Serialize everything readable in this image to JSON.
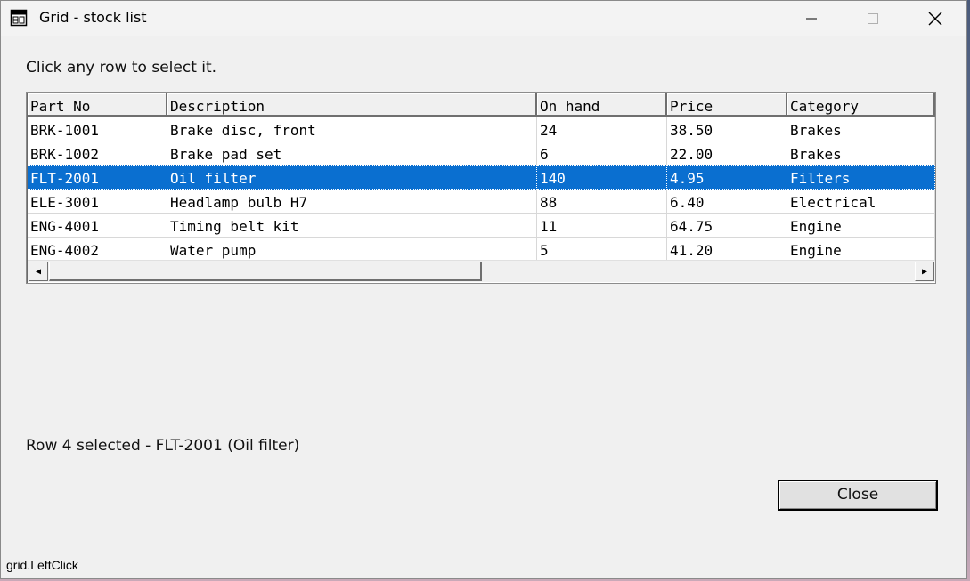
{
  "window": {
    "title": "Grid - stock list",
    "icon": "grid-app-icon",
    "controls": {
      "minimize": "minimize-icon",
      "maximize": "maximize-icon",
      "close": "close-icon"
    }
  },
  "instruction": "Click any row to select it.",
  "grid": {
    "columns": [
      "Part No",
      "Description",
      "On hand",
      "Price",
      "Category"
    ],
    "rows": [
      [
        "BRK-1001",
        "Brake disc, front",
        "24",
        "38.50",
        "Brakes"
      ],
      [
        "BRK-1002",
        "Brake pad set",
        "6",
        "22.00",
        "Brakes"
      ],
      [
        "FLT-2001",
        "Oil filter",
        "140",
        "4.95",
        "Filters"
      ],
      [
        "ELE-3001",
        "Headlamp bulb H7",
        "88",
        "6.40",
        "Electrical"
      ],
      [
        "ENG-4001",
        "Timing belt kit",
        "11",
        "64.75",
        "Engine"
      ],
      [
        "ENG-4002",
        "Water pump",
        "5",
        "41.20",
        "Engine"
      ]
    ],
    "selected_row_index": 2,
    "selection_color": "#0a6fd0"
  },
  "selection_status": "Row 4 selected - FLT-2001 (Oil filter)",
  "close_button": "Close",
  "statusbar": "grid.LeftClick"
}
